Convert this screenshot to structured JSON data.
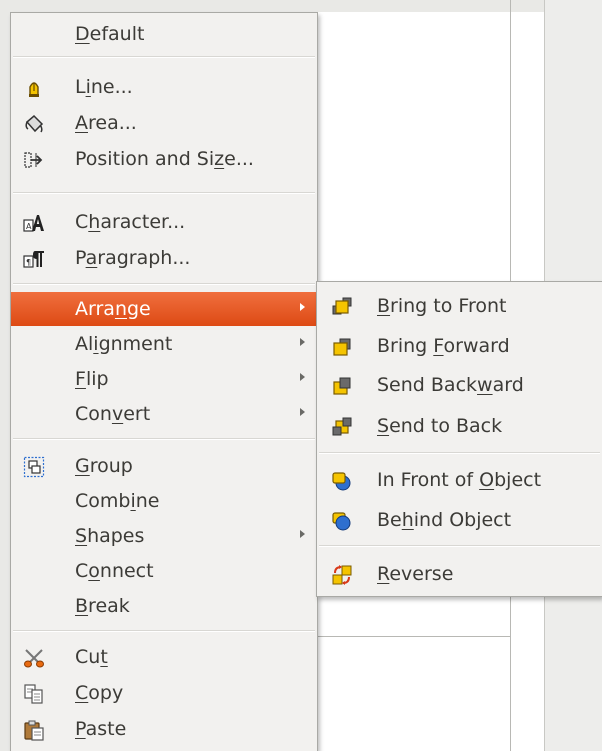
{
  "main_menu": {
    "items": [
      {
        "id": "default",
        "label_pre": "",
        "mnemonic": "D",
        "label_post": "efault",
        "icon": "none",
        "submenu": false
      },
      {
        "id": "line",
        "label_pre": "L",
        "mnemonic": "i",
        "label_post": "ne...",
        "icon": "line-pen-icon",
        "submenu": false
      },
      {
        "id": "area",
        "label_pre": "",
        "mnemonic": "A",
        "label_post": "rea...",
        "icon": "paint-bucket-icon",
        "submenu": false
      },
      {
        "id": "position-size",
        "label_pre": "Position and Si",
        "mnemonic": "z",
        "label_post": "e...",
        "icon": "position-size-icon",
        "submenu": false
      },
      {
        "id": "character",
        "label_pre": "C",
        "mnemonic": "h",
        "label_post": "aracter...",
        "icon": "character-icon",
        "submenu": false
      },
      {
        "id": "paragraph",
        "label_pre": "P",
        "mnemonic": "a",
        "label_post": "ragraph...",
        "icon": "paragraph-icon",
        "submenu": false
      },
      {
        "id": "arrange",
        "label_pre": "Arra",
        "mnemonic": "n",
        "label_post": "ge",
        "icon": "none",
        "submenu": true
      },
      {
        "id": "alignment",
        "label_pre": "Al",
        "mnemonic": "i",
        "label_post": "gnment",
        "icon": "none",
        "submenu": true
      },
      {
        "id": "flip",
        "label_pre": "",
        "mnemonic": "F",
        "label_post": "lip",
        "icon": "none",
        "submenu": true
      },
      {
        "id": "convert",
        "label_pre": "Con",
        "mnemonic": "v",
        "label_post": "ert",
        "icon": "none",
        "submenu": true
      },
      {
        "id": "group",
        "label_pre": "",
        "mnemonic": "G",
        "label_post": "roup",
        "icon": "group-icon",
        "submenu": false
      },
      {
        "id": "combine",
        "label_pre": "Comb",
        "mnemonic": "i",
        "label_post": "ne",
        "icon": "none",
        "submenu": false
      },
      {
        "id": "shapes",
        "label_pre": "",
        "mnemonic": "S",
        "label_post": "hapes",
        "icon": "none",
        "submenu": true
      },
      {
        "id": "connect",
        "label_pre": "C",
        "mnemonic": "o",
        "label_post": "nnect",
        "icon": "none",
        "submenu": false
      },
      {
        "id": "break",
        "label_pre": "",
        "mnemonic": "B",
        "label_post": "reak",
        "icon": "none",
        "submenu": false
      },
      {
        "id": "cut",
        "label_pre": "Cu",
        "mnemonic": "t",
        "label_post": "",
        "icon": "scissors-icon",
        "submenu": false
      },
      {
        "id": "copy",
        "label_pre": "",
        "mnemonic": "C",
        "label_post": "opy",
        "icon": "copy-icon",
        "submenu": false
      },
      {
        "id": "paste",
        "label_pre": "",
        "mnemonic": "P",
        "label_post": "aste",
        "icon": "paste-icon",
        "submenu": false
      }
    ],
    "active_item": "Arrange"
  },
  "arrange_submenu": {
    "items": [
      {
        "id": "bring-to-front",
        "label_pre": "",
        "mnemonic": "B",
        "label_post": "ring to Front",
        "icon": "bring-to-front-icon"
      },
      {
        "id": "bring-forward",
        "label_pre": "Bring ",
        "mnemonic": "F",
        "label_post": "orward",
        "icon": "bring-forward-icon"
      },
      {
        "id": "send-backward",
        "label_pre": "Send Back",
        "mnemonic": "w",
        "label_post": "ard",
        "icon": "send-backward-icon"
      },
      {
        "id": "send-to-back",
        "label_pre": "",
        "mnemonic": "S",
        "label_post": "end to Back",
        "icon": "send-to-back-icon"
      },
      {
        "id": "in-front-of-object",
        "label_pre": "In Front of ",
        "mnemonic": "O",
        "label_post": "bject",
        "icon": "in-front-of-object-icon"
      },
      {
        "id": "behind-object",
        "label_pre": "Be",
        "mnemonic": "h",
        "label_post": "ind Object",
        "icon": "behind-object-icon"
      },
      {
        "id": "reverse",
        "label_pre": "",
        "mnemonic": "R",
        "label_post": "everse",
        "icon": "reverse-icon"
      }
    ]
  },
  "colors": {
    "menu_bg": "#f2f1ef",
    "highlight_start": "#f06f3e",
    "highlight_end": "#dd4a14",
    "text": "#3c3b37",
    "icon_yellow": "#f5c400",
    "icon_blue": "#2e6fcf"
  }
}
